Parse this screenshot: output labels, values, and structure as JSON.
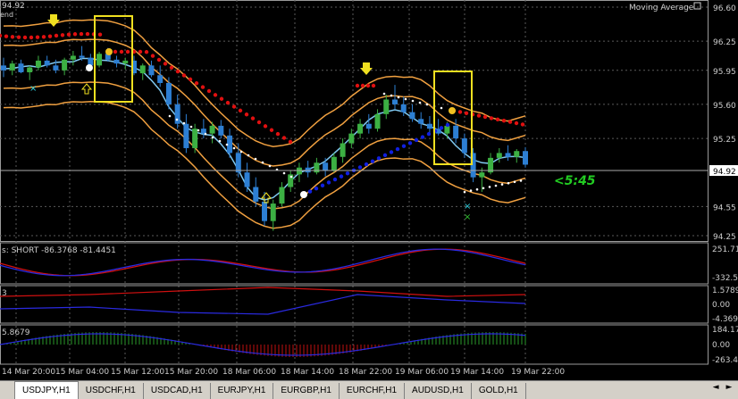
{
  "chart_data": {
    "type": "candlestick",
    "symbol": "USDJPY",
    "timeframe": "H1",
    "indicator_label": "Moving Average",
    "current_price": "94.92",
    "timer": "<5:45",
    "top_left_label": "94.92",
    "top_left_label2": "end",
    "price_axis": [
      "96.60",
      "96.25",
      "95.95",
      "95.60",
      "95.25",
      "94.92",
      "94.55",
      "94.25"
    ],
    "price_levels": [
      96.6,
      96.25,
      95.95,
      95.6,
      95.25,
      94.92,
      94.55,
      94.25
    ],
    "price_range": [
      94.2,
      96.62
    ],
    "time_axis": [
      "14 Mar 20:00",
      "15 Mar 04:00",
      "15 Mar 12:00",
      "15 Mar 20:00",
      "18 Mar 06:00",
      "18 Mar 14:00",
      "18 Mar 22:00",
      "19 Mar 06:00",
      "19 Mar 14:00",
      "19 Mar 22:00"
    ],
    "candles": [
      [
        96.0,
        96.08,
        95.88,
        95.95
      ],
      [
        95.95,
        96.05,
        95.9,
        96.02
      ],
      [
        96.02,
        96.06,
        95.92,
        95.93
      ],
      [
        95.93,
        96.0,
        95.85,
        95.98
      ],
      [
        95.98,
        96.1,
        95.95,
        96.05
      ],
      [
        96.05,
        96.1,
        95.98,
        96.0
      ],
      [
        96.0,
        96.06,
        95.92,
        95.95
      ],
      [
        95.95,
        96.08,
        95.9,
        96.06
      ],
      [
        96.06,
        96.15,
        96.0,
        96.1
      ],
      [
        96.1,
        96.2,
        96.05,
        96.08
      ],
      [
        96.08,
        96.12,
        95.98,
        96.0
      ],
      [
        96.0,
        96.14,
        95.98,
        96.12
      ],
      [
        96.12,
        96.18,
        96.04,
        96.06
      ],
      [
        96.06,
        96.1,
        95.98,
        96.02
      ],
      [
        96.02,
        96.08,
        95.96,
        96.05
      ],
      [
        96.05,
        96.1,
        95.9,
        95.92
      ],
      [
        95.92,
        96.02,
        95.85,
        96.0
      ],
      [
        96.0,
        96.05,
        95.88,
        95.9
      ],
      [
        95.9,
        96.0,
        95.78,
        95.82
      ],
      [
        95.82,
        95.88,
        95.55,
        95.6
      ],
      [
        95.6,
        95.7,
        95.35,
        95.4
      ],
      [
        95.4,
        95.5,
        95.1,
        95.15
      ],
      [
        95.15,
        95.4,
        95.1,
        95.35
      ],
      [
        95.35,
        95.45,
        95.25,
        95.3
      ],
      [
        95.3,
        95.42,
        95.2,
        95.38
      ],
      [
        95.38,
        95.44,
        95.25,
        95.28
      ],
      [
        95.28,
        95.35,
        95.05,
        95.1
      ],
      [
        95.1,
        95.2,
        94.85,
        94.9
      ],
      [
        94.9,
        95.0,
        94.7,
        94.75
      ],
      [
        94.75,
        94.85,
        94.55,
        94.6
      ],
      [
        94.6,
        94.7,
        94.35,
        94.4
      ],
      [
        94.4,
        94.62,
        94.3,
        94.58
      ],
      [
        94.58,
        94.8,
        94.55,
        94.75
      ],
      [
        94.75,
        94.92,
        94.7,
        94.88
      ],
      [
        94.88,
        95.0,
        94.8,
        94.95
      ],
      [
        94.95,
        95.02,
        94.85,
        94.9
      ],
      [
        94.9,
        95.05,
        94.88,
        95.0
      ],
      [
        95.0,
        95.05,
        94.86,
        94.92
      ],
      [
        94.92,
        95.1,
        94.9,
        95.06
      ],
      [
        95.06,
        95.25,
        95.0,
        95.2
      ],
      [
        95.2,
        95.35,
        95.15,
        95.3
      ],
      [
        95.3,
        95.45,
        95.25,
        95.4
      ],
      [
        95.4,
        95.5,
        95.3,
        95.35
      ],
      [
        95.35,
        95.55,
        95.32,
        95.5
      ],
      [
        95.5,
        95.7,
        95.45,
        95.65
      ],
      [
        95.65,
        95.8,
        95.55,
        95.6
      ],
      [
        95.6,
        95.68,
        95.48,
        95.52
      ],
      [
        95.52,
        95.6,
        95.42,
        95.45
      ],
      [
        95.45,
        95.52,
        95.35,
        95.4
      ],
      [
        95.4,
        95.48,
        95.3,
        95.35
      ],
      [
        95.35,
        95.45,
        95.28,
        95.3
      ],
      [
        95.3,
        95.42,
        95.25,
        95.38
      ],
      [
        95.38,
        95.45,
        95.2,
        95.25
      ],
      [
        95.25,
        95.3,
        95.05,
        95.1
      ],
      [
        95.1,
        95.15,
        94.8,
        94.85
      ],
      [
        94.85,
        94.95,
        94.7,
        94.9
      ],
      [
        94.9,
        95.1,
        94.88,
        95.05
      ],
      [
        95.05,
        95.15,
        95.0,
        95.1
      ],
      [
        95.1,
        95.18,
        95.02,
        95.06
      ],
      [
        95.06,
        95.14,
        95.0,
        95.12
      ],
      [
        95.12,
        95.16,
        94.95,
        94.98
      ]
    ],
    "subwindows": [
      {
        "label": "s: SHORT -86.3768 -81.4451",
        "axis": [
          "251.71",
          "-332.56"
        ]
      },
      {
        "label": "3",
        "axis": [
          "1.5789",
          "0.00",
          "-4.3691"
        ]
      },
      {
        "label": "5.8679",
        "axis": [
          "184.17",
          "0.00",
          "-263.49"
        ]
      }
    ]
  },
  "tabs": [
    "USDJPY,H1",
    "USDCHF,H1",
    "USDCAD,H1",
    "EURJPY,H1",
    "EURGBP,H1",
    "EURCHF,H1",
    "AUDUSD,H1",
    "GOLD,H1"
  ],
  "active_tab": 0,
  "nav_arrows": [
    "◄",
    "►"
  ],
  "colors": {
    "background": "#000000",
    "grid": "#5a5a5a",
    "bull": "#3cb043",
    "bear": "#2d7fd3",
    "band": "#f0a040",
    "stop_red": "#e01010",
    "stop_blue": "#1020e0",
    "ma": "#7fc8f0",
    "signal_box": "#f0e020",
    "timer": "#22cc22"
  }
}
